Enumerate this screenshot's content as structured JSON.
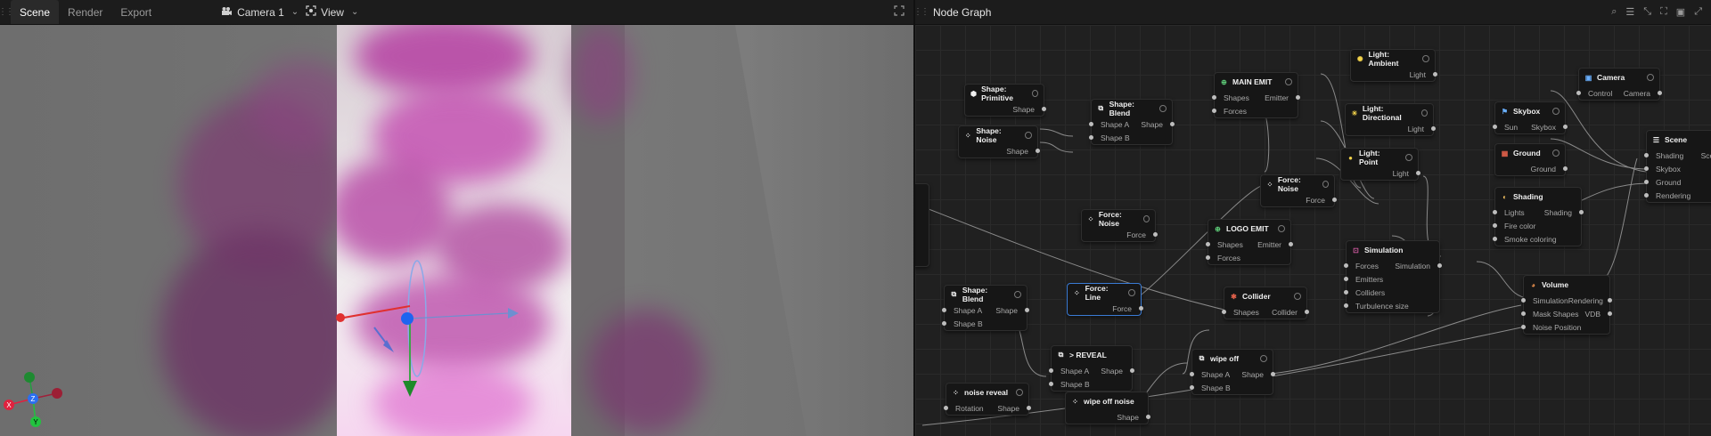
{
  "viewport_panel": {
    "tabs": [
      {
        "label": "Scene",
        "active": true
      },
      {
        "label": "Render",
        "active": false
      },
      {
        "label": "Export",
        "active": false
      }
    ],
    "camera_select": "Camera 1",
    "view_menu": "View",
    "axis_labels": {
      "x": "X",
      "y": "Y",
      "z": "Z"
    }
  },
  "node_panel": {
    "title": "Node Graph",
    "nodes": {
      "shape_primitive": {
        "title": "Shape: Primitive",
        "out": "Shape"
      },
      "shape_noise": {
        "title": "Shape: Noise",
        "out": "Shape"
      },
      "shape_blend_top": {
        "title": "Shape: Blend",
        "in1": "Shape A",
        "in2": "Shape B",
        "out": "Shape"
      },
      "main_emit": {
        "title": "MAIN EMIT",
        "in1": "Shapes",
        "in2": "Forces",
        "out": "Emitter"
      },
      "light_ambient": {
        "title": "Light: Ambient",
        "out": "Light"
      },
      "light_directional": {
        "title": "Light: Directional",
        "out": "Light"
      },
      "light_point": {
        "title": "Light: Point",
        "out": "Light"
      },
      "camera": {
        "title": "Camera",
        "in1": "Control",
        "out": "Camera"
      },
      "skybox": {
        "title": "Skybox",
        "in1": "Sun",
        "out": "Skybox"
      },
      "ground": {
        "title": "Ground",
        "out": "Ground"
      },
      "shading": {
        "title": "Shading",
        "in1": "Lights",
        "in2": "Fire color",
        "in3": "Smoke coloring",
        "out": "Shading"
      },
      "scene": {
        "title": "Scene",
        "in1": "Shading",
        "in2": "Skybox",
        "in3": "Ground",
        "in4": "Rendering",
        "out": "Scen"
      },
      "force_noise_a": {
        "title": "Force: Noise",
        "out": "Force"
      },
      "force_noise_b": {
        "title": "Force: Noise",
        "out": "Force"
      },
      "logo_emit": {
        "title": "LOGO EMIT",
        "in1": "Shapes",
        "in2": "Forces",
        "out": "Emitter"
      },
      "simulation": {
        "title": "Simulation",
        "in1": "Forces",
        "in2": "Emitters",
        "in3": "Colliders",
        "in4": "Turbulence size",
        "out": "Simulation"
      },
      "shape_blend_low": {
        "title": "Shape: Blend",
        "in1": "Shape A",
        "in2": "Shape B",
        "out": "Shape"
      },
      "force_line": {
        "title": "Force: Line",
        "out": "Force"
      },
      "collider": {
        "title": "Collider",
        "in1": "Shapes",
        "out": "Collider"
      },
      "volume": {
        "title": "Volume",
        "in1": "Simulation",
        "in2": "Mask Shapes",
        "in3": "Noise Position",
        "out1": "Rendering",
        "out2": "VDB"
      },
      "reveal": {
        "title": "> REVEAL",
        "in1": "Shape A",
        "in2": "Shape B",
        "out": "Shape"
      },
      "wipe_off": {
        "title": "wipe off",
        "in1": "Shape A",
        "in2": "Shape B",
        "out": "Shape"
      },
      "noise_reveal": {
        "title": "noise reveal",
        "in1": "Rotation",
        "out": "Shape"
      },
      "wipe_off_noise": {
        "title": "wipe off noise",
        "out": "Shape"
      }
    }
  },
  "colors": {
    "accent": "#3a7bd5",
    "smoke": "#b0409c",
    "selected_border": "#3a7bd5"
  }
}
